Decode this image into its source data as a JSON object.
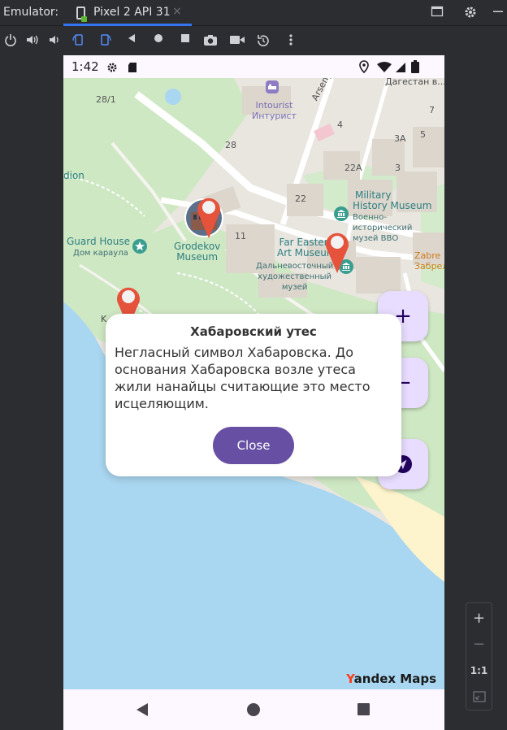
{
  "ide": {
    "label": "Emulator:",
    "tab_name": "Pixel 2 API 31",
    "tab_close": "×",
    "device_icon": "phone-device-icon",
    "window_buttons": [
      "restore-window-icon",
      "gear-icon",
      "minimize-icon"
    ],
    "toolbar_icons": [
      "power-icon",
      "volume-up-icon",
      "volume-down-icon",
      "rotate-left-icon",
      "rotate-right-icon",
      "back-icon",
      "home-icon",
      "overview-icon",
      "camera-icon",
      "video-icon",
      "snapshot-restore-icon",
      "more-icon"
    ],
    "accent": "#3574f0"
  },
  "zoom_panel": {
    "zoom_in": "+",
    "zoom_out": "−",
    "actual_size": "1:1",
    "fit_icon": "fit-screen-icon"
  },
  "status_bar": {
    "time": "1:42",
    "icons": [
      "gear-icon",
      "sd-card-icon",
      "location-icon",
      "wifi-icon",
      "signal-icon",
      "battery-icon"
    ]
  },
  "map": {
    "labels": {
      "intourist_en": "Intourist",
      "intourist_ru": "Интурист",
      "arsenyev": "Arsenyev",
      "dagestan": "Дагестан в...",
      "guard_house_en": "Guard House",
      "guard_house_ru": "Дом караула",
      "grodekov_1": "Grodekov",
      "grodekov_2": "Museum",
      "military_1": "Military",
      "military_2": "History Museum",
      "military_ru_1": "Военно-",
      "military_ru_2": "исторический",
      "military_ru_3": "музей ВВО",
      "far_eastern_1": "Far Eastern",
      "far_eastern_2": "Art Museum",
      "far_eastern_ru_1": "Дальневосточный",
      "far_eastern_ru_2": "художественный",
      "far_eastern_ru_3": "музей",
      "zabre_1": "Zabre",
      "zabre_2": "Забрел",
      "stadion": "dion",
      "left_k": "K"
    },
    "numbers": [
      "28/1",
      "28",
      "4",
      "7",
      "3A",
      "5",
      "22A",
      "3",
      "22",
      "11"
    ],
    "logo_y": "Y",
    "logo_rest": "andex Maps",
    "colors": {
      "park": "#cfe8c4",
      "water": "#a9d6f0",
      "sand": "#fdf3cc",
      "building": "#dcd6cd",
      "marker": "#e5533c"
    }
  },
  "fabs": {
    "zoom_in": "+",
    "zoom_out": "−",
    "location_icon": "navigation-arrow-icon"
  },
  "dialog": {
    "title": "Хабаровский утес",
    "body": "Негласный символ Хабаровска. До основания Хабаровска возле утеса жили нанайцы считающие это место исцеляющим.",
    "close": "Close",
    "button_color": "#6750a4"
  },
  "nav_bar": {
    "icons": [
      "back-triangle-icon",
      "home-circle-icon",
      "recent-square-icon"
    ]
  }
}
